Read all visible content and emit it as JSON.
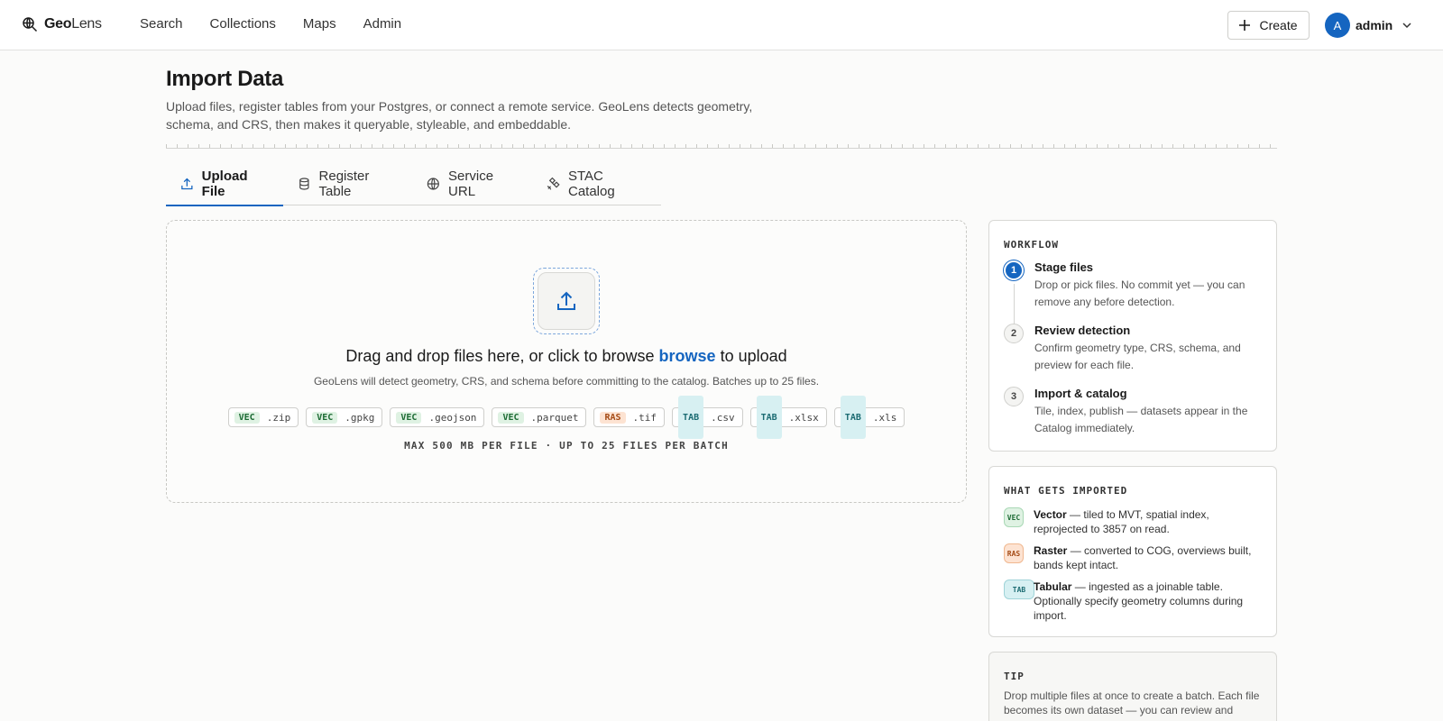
{
  "app": {
    "logo_bold": "Geo",
    "logo_light": "Lens"
  },
  "nav": [
    {
      "label": "Search"
    },
    {
      "label": "Collections"
    },
    {
      "label": "Maps"
    },
    {
      "label": "Admin"
    }
  ],
  "header": {
    "create_label": "Create",
    "avatar_initial": "A",
    "username": "admin"
  },
  "page": {
    "title": "Import Data",
    "description": "Upload files, register tables from your Postgres, or connect a remote service. GeoLens detects geometry, schema, and CRS, then makes it queryable, styleable, and embeddable."
  },
  "tabs": [
    {
      "label": "Upload File",
      "icon": "upload-icon",
      "active": true
    },
    {
      "label": "Register Table",
      "icon": "database-icon",
      "active": false
    },
    {
      "label": "Service URL",
      "icon": "globe-icon",
      "active": false
    },
    {
      "label": "STAC Catalog",
      "icon": "satellite-icon",
      "active": false
    }
  ],
  "dropzone": {
    "title_prefix": "Drag and drop files here, or click to browse",
    "title_link": "browse",
    "title_suffix": "to upload",
    "subtitle": "GeoLens will detect geometry, CRS, and schema before committing to the catalog. Batches up to 25 files.",
    "formats": [
      {
        "tag": "VEC",
        "ext": ".zip",
        "kind": "vec"
      },
      {
        "tag": "VEC",
        "ext": ".gpkg",
        "kind": "vec"
      },
      {
        "tag": "VEC",
        "ext": ".geojson",
        "kind": "vec"
      },
      {
        "tag": "VEC",
        "ext": ".parquet",
        "kind": "vec"
      },
      {
        "tag": "RAS",
        "ext": ".tif",
        "kind": "ras"
      },
      {
        "tag": "TAB",
        "ext": ".csv",
        "kind": "tab"
      },
      {
        "tag": "TAB",
        "ext": ".xlsx",
        "kind": "tab"
      },
      {
        "tag": "TAB",
        "ext": ".xls",
        "kind": "tab"
      }
    ],
    "limit": "MAX 500 MB PER FILE · UP TO 25 FILES PER BATCH"
  },
  "workflow": {
    "heading": "WORKFLOW",
    "steps": [
      {
        "num": "1",
        "title": "Stage files",
        "desc": "Drop or pick files. No commit yet — you can remove any before detection."
      },
      {
        "num": "2",
        "title": "Review detection",
        "desc": "Confirm geometry type, CRS, schema, and preview for each file."
      },
      {
        "num": "3",
        "title": "Import & catalog",
        "desc": "Tile, index, publish — datasets appear in the Catalog immediately."
      }
    ]
  },
  "imported": {
    "heading": "WHAT GETS IMPORTED",
    "items": [
      {
        "badge": "VEC",
        "name": "Vector",
        "desc": " — tiled to MVT, spatial index, reprojected to 3857 on read."
      },
      {
        "badge": "RAS",
        "name": "Raster",
        "desc": " — converted to COG, overviews built, bands kept intact."
      },
      {
        "badge": "TAB",
        "name": "Tabular",
        "desc": " — ingested as a joinable table. Optionally specify geometry columns during import."
      }
    ]
  },
  "tip": {
    "heading": "TIP",
    "text": "Drop multiple files at once to create a batch. Each file becomes its own dataset — you can review and"
  },
  "colors": {
    "accent": "#1565c0",
    "vec": "#1d6b34",
    "ras": "#a54b16",
    "tab": "#1b6b72"
  }
}
